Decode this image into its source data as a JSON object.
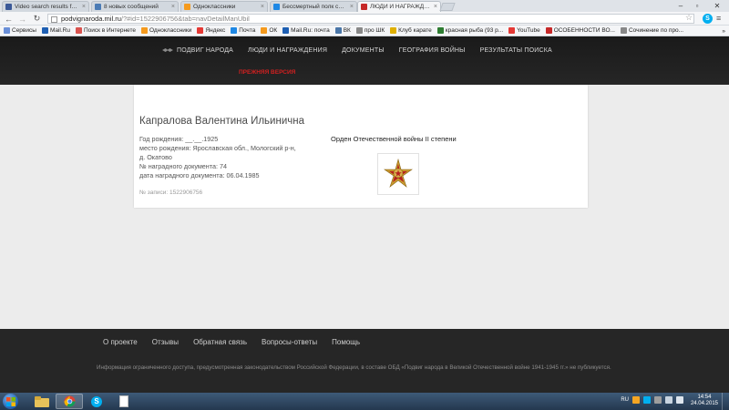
{
  "browser": {
    "tabs": [
      {
        "label": "Video search results for ч",
        "color": "#3b5998"
      },
      {
        "label": "8 новых сообщений",
        "color": "#4b7bb5"
      },
      {
        "label": "Одноклассники",
        "color": "#f59a1d"
      },
      {
        "label": "Бессмертный полк серге",
        "color": "#1e88e5"
      },
      {
        "label": "ЛЮДИ И НАГРАЖДЕНИЯ",
        "color": "#c62828"
      }
    ],
    "url_host": "podvignaroda.mil.ru",
    "url_path": "/?#id=1522906756&tab=navDetailManUbil",
    "bookmarks": [
      {
        "label": "Сервисы",
        "color": "#6a8fd8"
      },
      {
        "label": "Mail.Ru",
        "color": "#1e5fb3"
      },
      {
        "label": "Поиск в Интернете",
        "color": "#d9534f"
      },
      {
        "label": "Одноклассники",
        "color": "#f59a1d"
      },
      {
        "label": "Яндекс",
        "color": "#e53935"
      },
      {
        "label": "Почта",
        "color": "#1e88e5"
      },
      {
        "label": "ОК",
        "color": "#f59a1d"
      },
      {
        "label": "Mail.Ru: почта",
        "color": "#1e5fb3"
      },
      {
        "label": "ВК",
        "color": "#4a76a8"
      },
      {
        "label": "про ШК",
        "color": "#888888"
      },
      {
        "label": "Клуб карате",
        "color": "#e0b000"
      },
      {
        "label": "красная рыба (93 р...",
        "color": "#2e7d32"
      },
      {
        "label": "YouTube",
        "color": "#e53935"
      },
      {
        "label": "ОСОБЕННОСТИ ВО...",
        "color": "#c62828"
      },
      {
        "label": "Сочинение по про...",
        "color": "#888888"
      }
    ],
    "bookmarks_more": "»"
  },
  "site": {
    "nav": [
      "ПОДВИГ НАРОДА",
      "ЛЮДИ И НАГРАЖДЕНИЯ",
      "ДОКУМЕНТЫ",
      "ГЕОГРАФИЯ ВОЙНЫ",
      "РЕЗУЛЬТАТЫ ПОИСКА"
    ],
    "prev_version": "ПРЕЖНЯЯ ВЕРСИЯ"
  },
  "person": {
    "name": "Капралова Валентина Ильинична",
    "birth": "Год рождения: __.__.1925",
    "place_line1": "место рождения: Ярославская обл., Мологский р-н,",
    "place_line2": "д. Окатово",
    "doc_number": "№ наградного документа: 74",
    "doc_date": "дата наградного документа: 06.04.1985",
    "record": "№ записи: 1522906756"
  },
  "award": {
    "name": "Орден Отечественной войны II степени"
  },
  "footer": {
    "links": [
      "О проекте",
      "Отзывы",
      "Обратная связь",
      "Вопросы-ответы",
      "Помощь"
    ],
    "note": "Информация ограниченного доступа, предусмотренная законодательством Российской Федерации, в составе ОБД «Подвиг народа в Великой Отечественной войне 1941-1945 гг.» не публикуется."
  },
  "taskbar": {
    "lang": "RU",
    "time": "14:54",
    "date": "24.04.2015"
  }
}
